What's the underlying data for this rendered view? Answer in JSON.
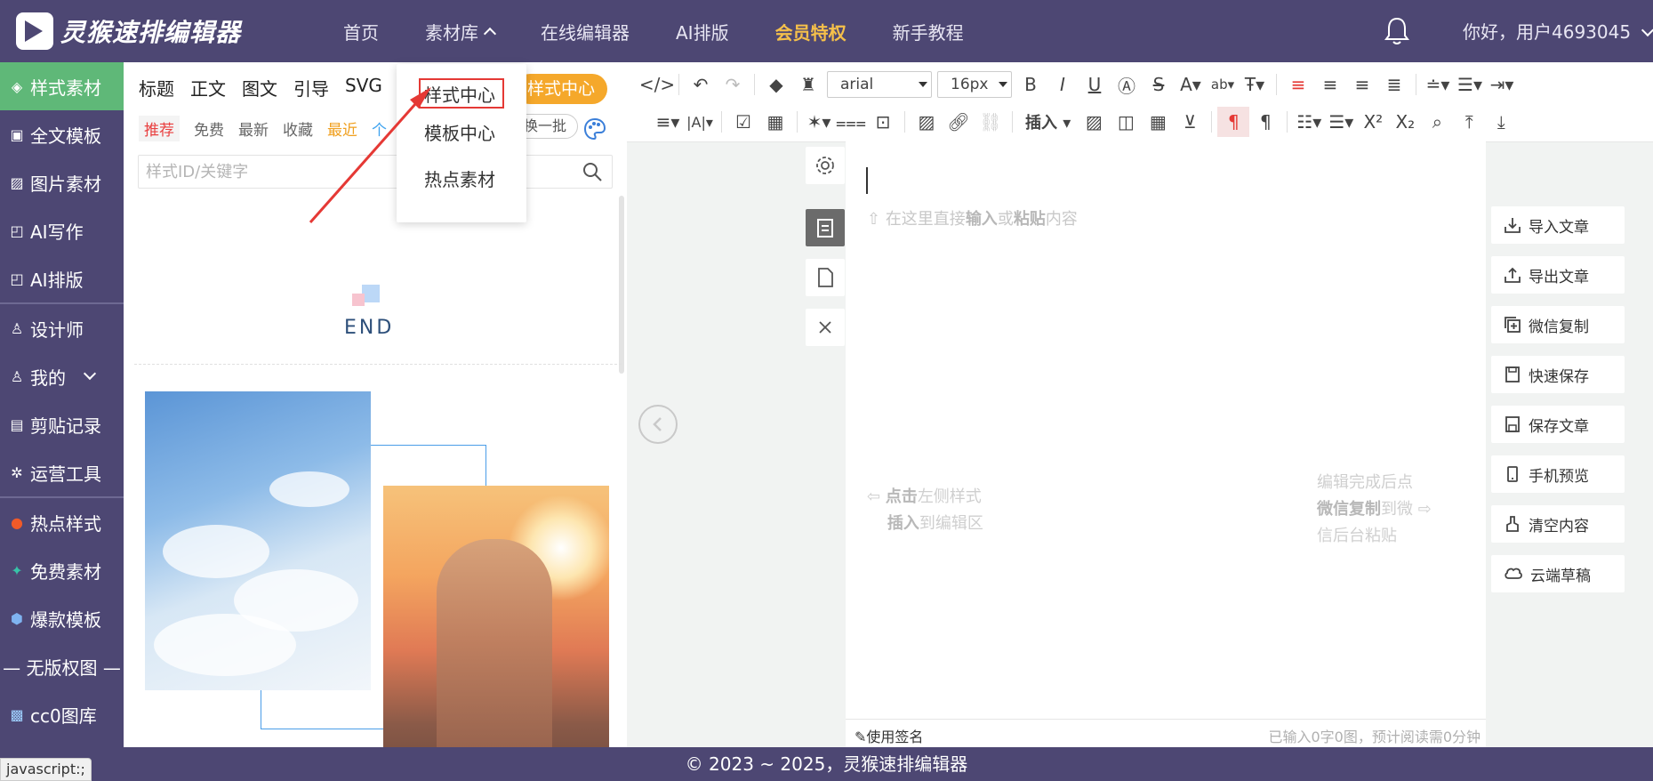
{
  "app": {
    "name": "灵猴速排编辑器"
  },
  "nav": {
    "items": [
      {
        "label": "首页"
      },
      {
        "label": "素材库"
      },
      {
        "label": "在线编辑器"
      },
      {
        "label": "AI排版"
      },
      {
        "label": "会员特权"
      },
      {
        "label": "新手教程"
      }
    ],
    "greeting": "你好，用户4693045"
  },
  "sidebar": {
    "items": [
      {
        "label": "样式素材"
      },
      {
        "label": "全文模板"
      },
      {
        "label": "图片素材"
      },
      {
        "label": "AI写作"
      },
      {
        "label": "AI排版"
      },
      {
        "label": "设计师"
      },
      {
        "label": "我的"
      },
      {
        "label": "剪贴记录"
      },
      {
        "label": "运营工具"
      },
      {
        "label": "热点样式"
      },
      {
        "label": "免费素材"
      },
      {
        "label": "爆款模板"
      }
    ],
    "section_title": "— 无版权图 —",
    "cc0": "cc0图库"
  },
  "panel": {
    "tabs": [
      "标题",
      "正文",
      "图文",
      "引导",
      "SVG"
    ],
    "pill": "样式中心",
    "filters": [
      "推荐",
      "免费",
      "最新",
      "收藏",
      "最近",
      "个"
    ],
    "swap": "换一批",
    "search_placeholder": "样式ID/关键字",
    "end_text": "END"
  },
  "dropdown": {
    "items": [
      "样式中心",
      "模板中心",
      "热点素材"
    ]
  },
  "toolbar": {
    "font": "arial",
    "size": "16px",
    "insert_label": "插入"
  },
  "editor": {
    "hint_top_pre": "在这里直接",
    "hint_top_b1": "输入",
    "hint_top_mid": "或",
    "hint_top_b2": "粘贴",
    "hint_top_post": "内容",
    "hint_left_b1": "点击",
    "hint_left_1": "左侧样式",
    "hint_left_b2": "插入",
    "hint_left_2": "到编辑区",
    "hint_right_1": "编辑完成后点",
    "hint_right_b": "微信复制",
    "hint_right_2": "到微",
    "hint_right_3": "信后台粘贴",
    "signature": "使用签名",
    "count": "已输入0字0图，预计阅读需0分钟"
  },
  "actions": [
    {
      "label": "导入文章"
    },
    {
      "label": "导出文章"
    },
    {
      "label": "微信复制"
    },
    {
      "label": "快速保存"
    },
    {
      "label": "保存文章"
    },
    {
      "label": "手机预览"
    },
    {
      "label": "清空内容"
    },
    {
      "label": "云端草稿"
    }
  ],
  "footer": {
    "copyright": "© 2023 ~ 2025，灵猴速排编辑器"
  },
  "status_url": "javascript:;",
  "colors": {
    "nav_bg": "#4d4773",
    "active_green": "#5fb878",
    "vip_gold": "#f5c04a",
    "pill_orange": "#f5a82b",
    "highlight_red": "#e53935"
  }
}
